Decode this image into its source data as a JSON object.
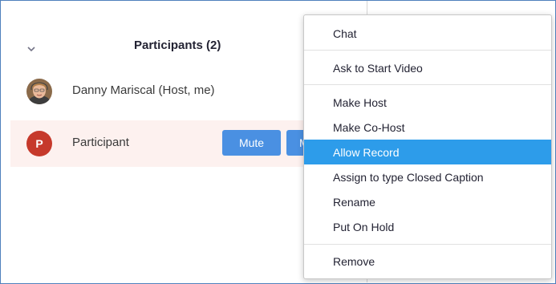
{
  "participants_panel": {
    "title": "Participants (2)",
    "participants": [
      {
        "name": "Danny Mariscal (Host, me)",
        "avatar_icon": "user-photo-avatar"
      },
      {
        "name": "Participant",
        "avatar_letter": "P",
        "avatar_color": "#c6392b",
        "mute_label": "Mute",
        "more_label": "M"
      }
    ]
  },
  "context_menu": {
    "items": [
      {
        "label": "Chat"
      },
      {
        "label": "Ask to Start Video"
      },
      {
        "label": "Make Host"
      },
      {
        "label": "Make Co-Host"
      },
      {
        "label": "Allow Record",
        "highlighted": true
      },
      {
        "label": "Assign to type Closed Caption"
      },
      {
        "label": "Rename"
      },
      {
        "label": "Put On Hold"
      },
      {
        "label": "Remove"
      }
    ],
    "highlight_color": "#2d9cea"
  },
  "colors": {
    "accent_button": "#4a90e2",
    "row_highlight": "#fdf1ef",
    "window_border": "#4f81bd"
  }
}
